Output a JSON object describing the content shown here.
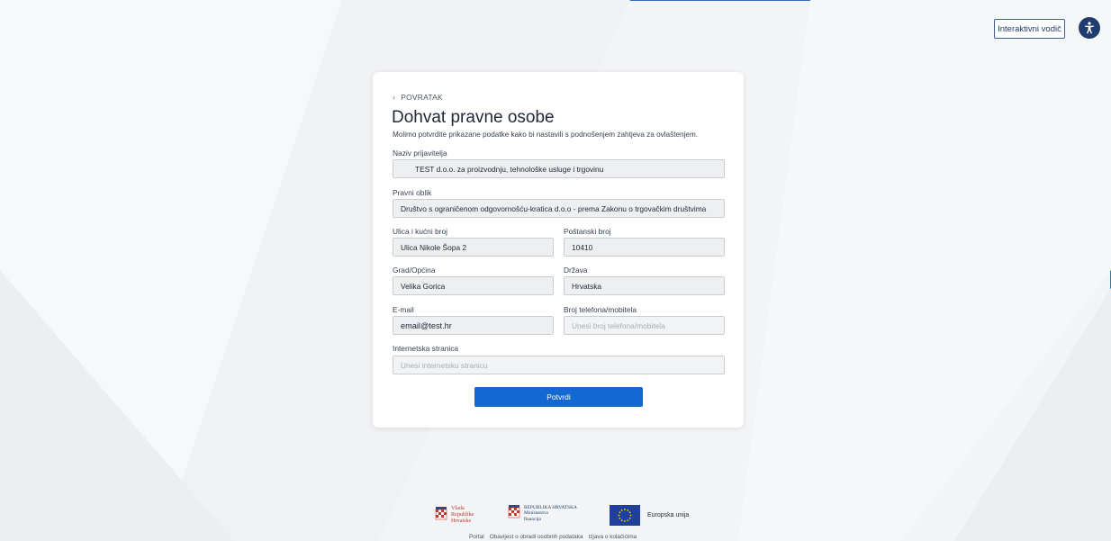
{
  "header": {
    "guide_label": "Interaktivni vodič",
    "accessibility_icon": "accessibility-icon"
  },
  "form": {
    "back_label": "POVRATAK",
    "title": "Dohvat pravne osobe",
    "subtitle": "Molimo potvrdite prikazane podatke kako bi nastavili s podnošenjem zahtjeva za ovlaštenjem.",
    "fields": {
      "applicant_name": {
        "label": "Naziv prijavitelja",
        "value": "TEST d.o.o. za proizvodnju, tehnološke usluge i trgovinu"
      },
      "legal_form": {
        "label": "Pravni oblik",
        "value": "Društvo s ograničenom odgovornošću-kratica d.o.o - prema Zakonu o trgovačkim društvima"
      },
      "street": {
        "label": "Ulica i kućni broj",
        "value": "Ulica Nikole Šopa 2"
      },
      "postal_code": {
        "label": "Poštanski broj",
        "value": "10410"
      },
      "city": {
        "label": "Grad/Općina",
        "value": "Velika Gorica"
      },
      "country": {
        "label": "Država",
        "value": "Hrvatska"
      },
      "email": {
        "label": "E-mail",
        "value": "email@test.hr"
      },
      "phone": {
        "label": "Broj telefona/mobitela",
        "placeholder": "Unesi broj telefona/mobitela"
      },
      "website": {
        "label": "Internetska stranica",
        "placeholder": "Unesi internetsku stranicu"
      }
    },
    "submit_label": "Potvrdi"
  },
  "footer": {
    "logos": {
      "vlada": [
        "Vlada",
        "Republike",
        "Hrvatske"
      ],
      "ministarstvo": [
        "REPUBLIKA HRVATSKA",
        "Ministarstvo",
        "financija"
      ],
      "eu": "Europska unija"
    },
    "links": [
      "Portal",
      "Obavijest o obradi osobnih podataka",
      "Izjava o kolačićima"
    ]
  },
  "colors": {
    "primary": "#1369d1",
    "navy": "#1f3c6e",
    "background": "#f3f4f6",
    "input_bg": "#eeeff1"
  }
}
